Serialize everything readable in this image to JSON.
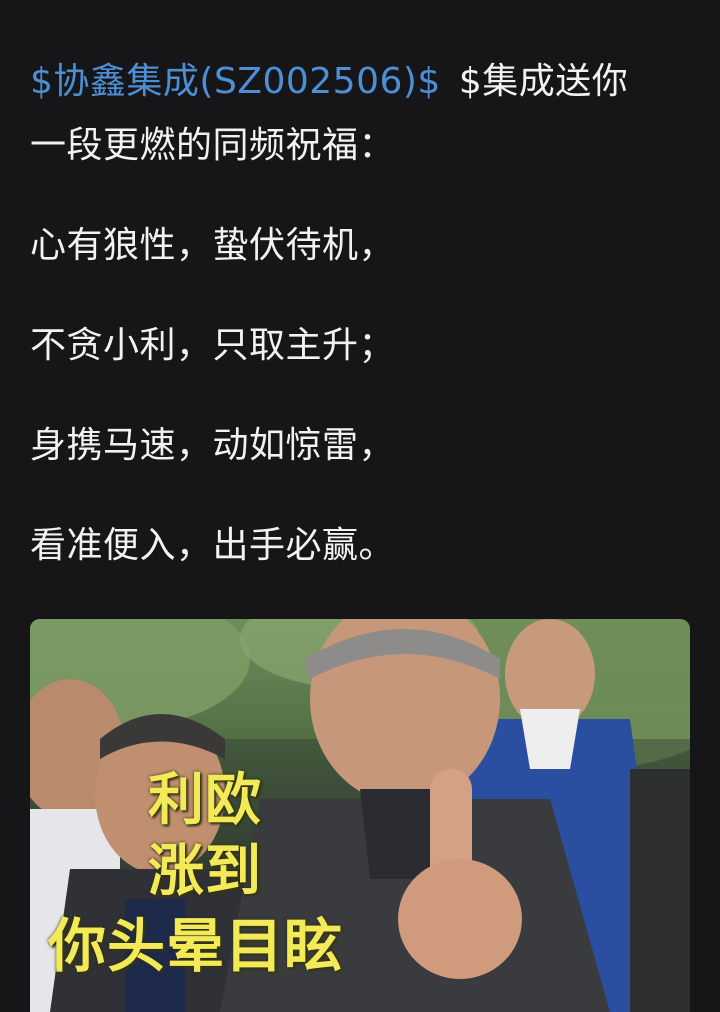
{
  "post": {
    "stock_tag": "$协鑫集成(SZ002506)$",
    "topic_tag": "$集成送你",
    "intro_continuation": "一段更燃的同频祝福：",
    "verses": [
      "心有狼性，蛰伏待机，",
      "不贪小利，只取主升；",
      "身携马速，动如惊雷，",
      "看准便入，出手必赢。"
    ]
  },
  "media": {
    "caption_lines": [
      "利欧",
      "涨到",
      "你头晕目眩"
    ]
  }
}
